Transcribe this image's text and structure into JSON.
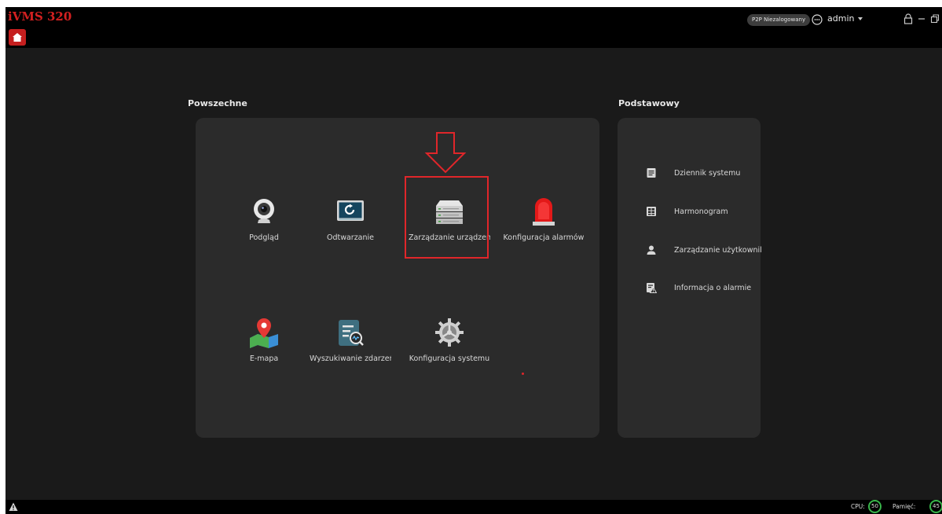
{
  "app": {
    "title": "iVMS 320",
    "p2p_status": "P2P Niezalogowany",
    "user": "admin"
  },
  "sections": {
    "common_title": "Powszechne",
    "basic_title": "Podstawowy"
  },
  "common_tiles": [
    {
      "label": "Podgląd",
      "icon": "camera-icon"
    },
    {
      "label": "Odtwarzanie",
      "icon": "playback-monitor-icon"
    },
    {
      "label": "Zarządzanie urządzeni",
      "icon": "device-server-icon"
    },
    {
      "label": "Konfiguracja alarmów",
      "icon": "alarm-light-icon"
    },
    {
      "label": "E-mapa",
      "icon": "map-pin-icon"
    },
    {
      "label": "Wyszukiwanie zdarzeń",
      "icon": "event-search-icon"
    },
    {
      "label": "Konfiguracja systemu",
      "icon": "gear-icon"
    }
  ],
  "basic_items": [
    {
      "label": "Dziennik systemu",
      "icon": "document-icon"
    },
    {
      "label": "Harmonogram",
      "icon": "schedule-icon"
    },
    {
      "label": "Zarządzanie użytkownil",
      "icon": "user-icon"
    },
    {
      "label": "Informacja o alarmie",
      "icon": "alarm-info-icon"
    }
  ],
  "status": {
    "cpu_label": "CPU:",
    "cpu_value": "50",
    "memory_label": "Pamięć:",
    "memory_value": "45"
  },
  "colors": {
    "accent": "#c51f1f",
    "panel": "#2b2b2b",
    "ok": "#38b44a"
  }
}
